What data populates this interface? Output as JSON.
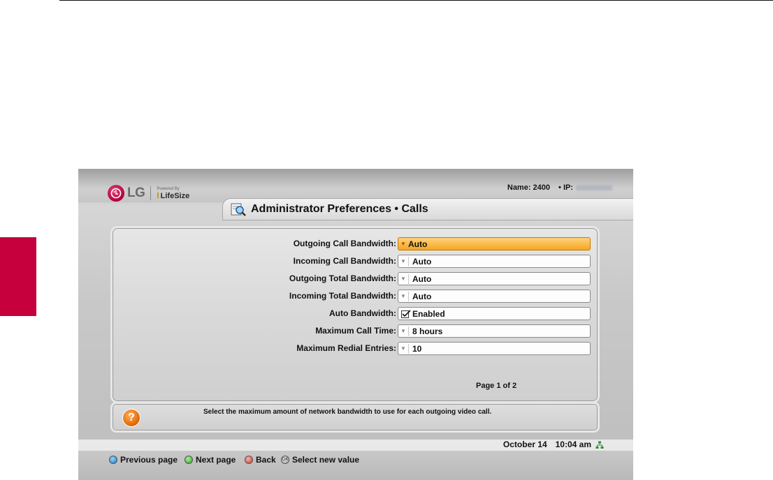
{
  "header": {
    "logo": {
      "mark": "LG",
      "powered_by": "Powered By",
      "brand": "LifeSize"
    },
    "name": "Name: 2400",
    "ip_label": "• IP:",
    "title": "Administrator Preferences • Calls"
  },
  "settings": [
    {
      "label": "Outgoing Call Bandwidth:",
      "value": "Auto",
      "active": true
    },
    {
      "label": "Incoming Call Bandwidth:",
      "value": "Auto"
    },
    {
      "label": "Outgoing Total Bandwidth:",
      "value": "Auto"
    },
    {
      "label": "Incoming Total Bandwidth:",
      "value": "Auto"
    },
    {
      "label": "Auto Bandwidth:",
      "value": "Enabled",
      "checked": true
    },
    {
      "label": "Maximum Call Time:",
      "value": "8 hours"
    },
    {
      "label": "Maximum Redial Entries:",
      "value": "10"
    }
  ],
  "page_indicator": "Page 1 of 2",
  "help": {
    "icon": "question-icon",
    "text": "Select the maximum amount of network bandwidth to use for each outgoing video call."
  },
  "status": {
    "date": "October 14",
    "time": "10:04 am",
    "network_icon": "network-icon"
  },
  "nav": [
    {
      "label": "Previous page",
      "color": "blue"
    },
    {
      "label": "Next page",
      "color": "green"
    },
    {
      "label": "Back",
      "color": "red"
    },
    {
      "label": "Select new value",
      "color": "ok"
    }
  ],
  "colors": {
    "accent_tab": "#c5003d",
    "active_field": "#f5a623"
  }
}
